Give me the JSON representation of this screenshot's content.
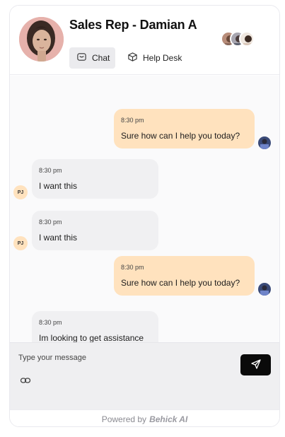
{
  "header": {
    "agent_name": "Sales Rep - Damian A",
    "tabs": [
      {
        "label": "Chat",
        "icon": "chat-bubble-icon",
        "active": true
      },
      {
        "label": "Help Desk",
        "icon": "box-icon",
        "active": false
      }
    ]
  },
  "messages": [
    {
      "direction": "out",
      "time": "8:30 pm",
      "text": "Sure how can I help you today?"
    },
    {
      "direction": "in",
      "time": "8:30 pm",
      "text": "I want this",
      "initials": "PJ"
    },
    {
      "direction": "in",
      "time": "8:30 pm",
      "text": "I want this",
      "initials": "PJ"
    },
    {
      "direction": "out",
      "time": "8:30 pm",
      "text": "Sure how can I help you today?"
    },
    {
      "direction": "in",
      "time": "8:30 pm",
      "text": "Im looking to get assistance"
    }
  ],
  "composer": {
    "placeholder": "Type your message",
    "attach_icon": "link-icon",
    "send_icon": "send-icon"
  },
  "footer": {
    "prefix": "Powered by",
    "brand": "Behick AI"
  },
  "colors": {
    "outgoing_bubble": "#ffe2be",
    "incoming_bubble": "#f0f0f2",
    "send_button": "#0a0a0a"
  }
}
